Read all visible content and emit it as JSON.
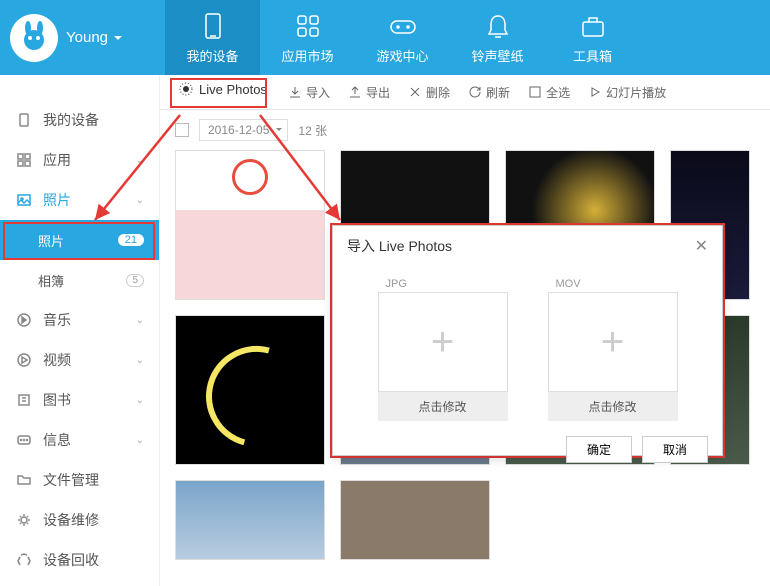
{
  "header": {
    "username": "Young",
    "nav": [
      {
        "label": "我的设备"
      },
      {
        "label": "应用市场"
      },
      {
        "label": "游戏中心"
      },
      {
        "label": "铃声壁纸"
      },
      {
        "label": "工具箱"
      }
    ]
  },
  "toolbar": {
    "live_photos": "Live Photos",
    "import": "导入",
    "export": "导出",
    "delete": "删除",
    "refresh": "刷新",
    "select_all": "全选",
    "slideshow": "幻灯片播放"
  },
  "datebar": {
    "date": "2016-12-05",
    "count": "12 张"
  },
  "sidebar": {
    "items": [
      {
        "label": "我的设备"
      },
      {
        "label": "应用"
      },
      {
        "label": "照片"
      },
      {
        "label": "照片",
        "badge": "21"
      },
      {
        "label": "相簿",
        "count": "5"
      },
      {
        "label": "音乐"
      },
      {
        "label": "视频"
      },
      {
        "label": "图书"
      },
      {
        "label": "信息"
      },
      {
        "label": "文件管理"
      },
      {
        "label": "设备维修"
      },
      {
        "label": "设备回收"
      }
    ]
  },
  "dialog": {
    "title": "导入 Live Photos",
    "jpg_label": "JPG",
    "mov_label": "MOV",
    "click_modify": "点击修改",
    "ok": "确定",
    "cancel": "取消"
  }
}
